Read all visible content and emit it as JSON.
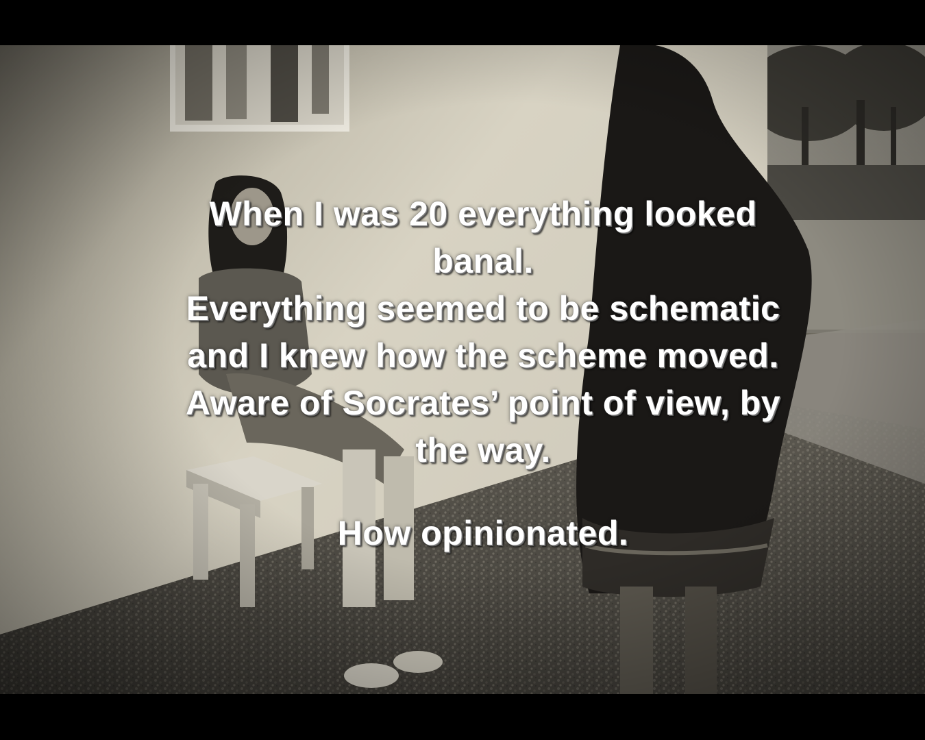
{
  "caption": {
    "lines": [
      "When I was 20 everything looked",
      "banal.",
      "Everything seemed to be schematic",
      "and I knew how the scheme moved.",
      "Aware of Socrates’ point of view, by",
      "the way."
    ],
    "closing": "How opinionated."
  },
  "colors": {
    "letterbox": "#000000",
    "wall": "#c9c4b4",
    "gravel": "#4a4740",
    "caption_text": "#ffffff"
  }
}
